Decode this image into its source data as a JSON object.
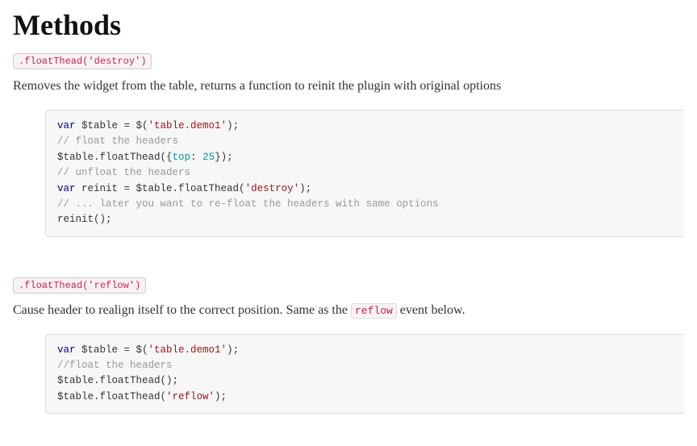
{
  "heading": "Methods",
  "methods": [
    {
      "tag": ".floatThead('destroy')",
      "desc_before": "Removes the widget from the table, returns a function to reinit the plugin with original options",
      "desc_inline": "",
      "desc_after": "",
      "code": [
        [
          [
            "kw",
            "var"
          ],
          [
            "txt",
            " $table = $("
          ],
          [
            "str",
            "'table.demo1'"
          ],
          [
            "txt",
            ");"
          ]
        ],
        [
          [
            "com",
            "// float the headers"
          ]
        ],
        [
          [
            "txt",
            "$table.floatThead({"
          ],
          [
            "num",
            "top"
          ],
          [
            "txt",
            ": "
          ],
          [
            "num",
            "25"
          ],
          [
            "txt",
            "});"
          ]
        ],
        [
          [
            "com",
            "// unfloat the headers"
          ]
        ],
        [
          [
            "kw",
            "var"
          ],
          [
            "txt",
            " reinit = $table.floatThead("
          ],
          [
            "str",
            "'destroy'"
          ],
          [
            "txt",
            ");"
          ]
        ],
        [
          [
            "com",
            "// ... later you want to re-float the headers with same options"
          ]
        ],
        [
          [
            "txt",
            "reinit();"
          ]
        ]
      ]
    },
    {
      "tag": ".floatThead('reflow')",
      "desc_before": "Cause header to realign itself to the correct position. Same as the ",
      "desc_inline": "reflow",
      "desc_after": " event below.",
      "code": [
        [
          [
            "kw",
            "var"
          ],
          [
            "txt",
            " $table = $("
          ],
          [
            "str",
            "'table.demo1'"
          ],
          [
            "txt",
            ");"
          ]
        ],
        [
          [
            "com",
            "//float the headers"
          ]
        ],
        [
          [
            "txt",
            "$table.floatThead();"
          ]
        ],
        [
          [
            "txt",
            "$table.floatThead("
          ],
          [
            "str",
            "'reflow'"
          ],
          [
            "txt",
            ");"
          ]
        ]
      ]
    }
  ]
}
